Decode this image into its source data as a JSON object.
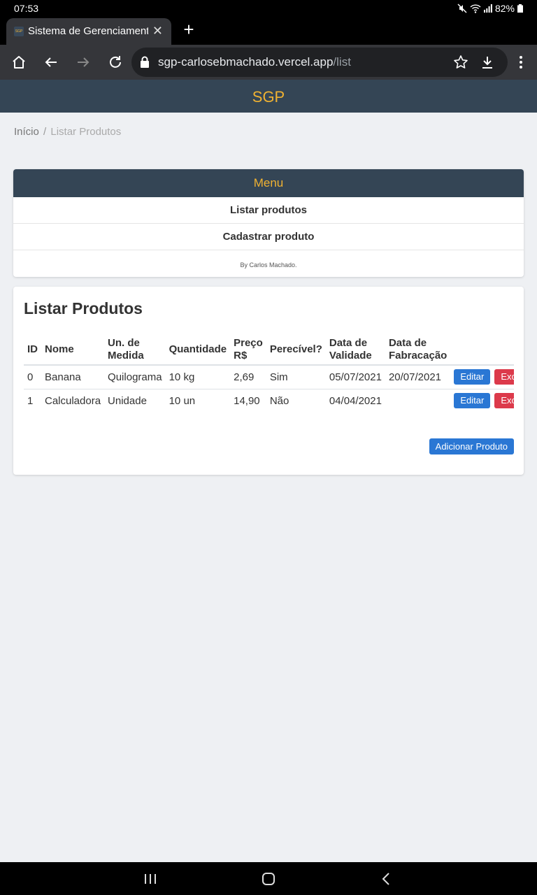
{
  "status": {
    "time": "07:53",
    "battery": "82%"
  },
  "browser": {
    "tab_title": "Sistema de Gerenciamento",
    "favicon_text": "SGP",
    "url_host": "sgp-carlosebmachado.vercel.app",
    "url_path": "/list"
  },
  "app": {
    "brand": "SGP"
  },
  "breadcrumb": {
    "home": "Início",
    "separator": "/",
    "current": "Listar Produtos"
  },
  "menu": {
    "title": "Menu",
    "items": [
      "Listar produtos",
      "Cadastrar produto"
    ],
    "footer": "By Carlos Machado."
  },
  "list": {
    "title": "Listar Produtos",
    "headers": [
      "ID",
      "Nome",
      "Un. de\nMedida",
      "Quantidade",
      "Preço\nR$",
      "Perecível?",
      "Data de\nValidade",
      "Data de\nFabracação"
    ],
    "rows": [
      [
        "0",
        "Banana",
        "Quilograma",
        "10 kg",
        "2,69",
        "Sim",
        "05/07/2021",
        "20/07/2021"
      ],
      [
        "1",
        "Calculadora",
        "Unidade",
        "10 un",
        "14,90",
        "Não",
        "04/04/2021",
        ""
      ]
    ],
    "edit_label": "Editar",
    "delete_label": "Excluir",
    "add_label": "Adicionar Produto"
  },
  "colors": {
    "header_bg": "#344555",
    "brand": "#f0b232",
    "primary": "#2a77d4",
    "danger": "#dc3a4b"
  }
}
